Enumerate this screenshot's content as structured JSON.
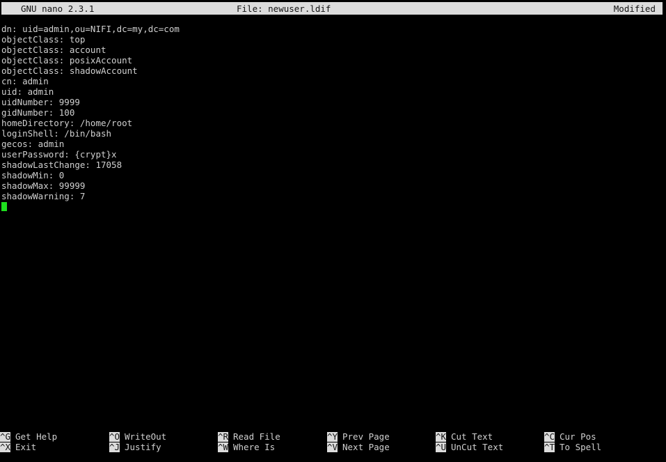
{
  "titlebar": {
    "version": "GNU nano 2.3.1",
    "file": "File: newuser.ldif",
    "state": "Modified",
    "background_color": "#dcdcdc",
    "text_color": "#111111"
  },
  "editor": {
    "background_color": "#000000",
    "text_color": "#d0d0d0",
    "cursor_color": "#1ee01e",
    "lines": [
      "dn: uid=admin,ou=NIFI,dc=my,dc=com",
      "objectClass: top",
      "objectClass: account",
      "objectClass: posixAccount",
      "objectClass: shadowAccount",
      "cn: admin",
      "uid: admin",
      "uidNumber: 9999",
      "gidNumber: 100",
      "homeDirectory: /home/root",
      "loginShell: /bin/bash",
      "gecos: admin",
      "userPassword: {crypt}x",
      "shadowLastChange: 17058",
      "shadowMin: 0",
      "shadowMax: 99999",
      "shadowWarning: 7"
    ]
  },
  "helpbar": {
    "row1": [
      {
        "key": "^G",
        "label": "Get Help"
      },
      {
        "key": "^O",
        "label": "WriteOut"
      },
      {
        "key": "^R",
        "label": "Read File"
      },
      {
        "key": "^Y",
        "label": "Prev Page"
      },
      {
        "key": "^K",
        "label": "Cut Text"
      },
      {
        "key": "^C",
        "label": "Cur Pos"
      }
    ],
    "row2": [
      {
        "key": "^X",
        "label": "Exit"
      },
      {
        "key": "^J",
        "label": "Justify"
      },
      {
        "key": "^W",
        "label": "Where Is"
      },
      {
        "key": "^V",
        "label": "Next Page"
      },
      {
        "key": "^U",
        "label": "UnCut Text"
      },
      {
        "key": "^T",
        "label": "To Spell"
      }
    ],
    "column_offsets": [
      0,
      157,
      313,
      470,
      626,
      782
    ]
  }
}
